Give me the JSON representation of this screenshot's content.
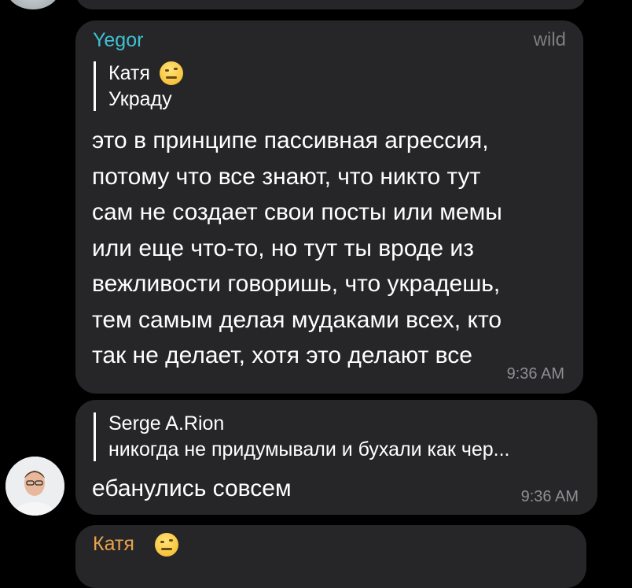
{
  "messages": [
    {
      "sender": "Yegor",
      "sender_title": "wild",
      "reply": {
        "author": "Катя",
        "text": "Украду"
      },
      "text_lines": [
        "это в принципе пассивная агрессия,",
        "потому что все знают, что никто тут",
        "сам не создает свои посты или мемы",
        "или еще что-то, но тут ты вроде из",
        "вежливости говоришь, что украдешь,",
        "тем самым делая мудаками всех, кто",
        "так не делает, хотя это делают все"
      ],
      "time": "9:36 AM"
    },
    {
      "reply": {
        "author": "Serge A.Rion",
        "text": "никогда не придумывали и бухали как чер..."
      },
      "text": "ебанулись совсем",
      "time": "9:36 AM"
    },
    {
      "sender": "Катя"
    }
  ],
  "colors": {
    "background": "#000000",
    "bubble": "#262628",
    "yegor_name": "#3ec1d3",
    "katya_name": "#e8a24d",
    "timestamp": "#8e8e93"
  },
  "icons": {
    "reply_emoji": "face-with-raised-eyebrow-emoji"
  }
}
